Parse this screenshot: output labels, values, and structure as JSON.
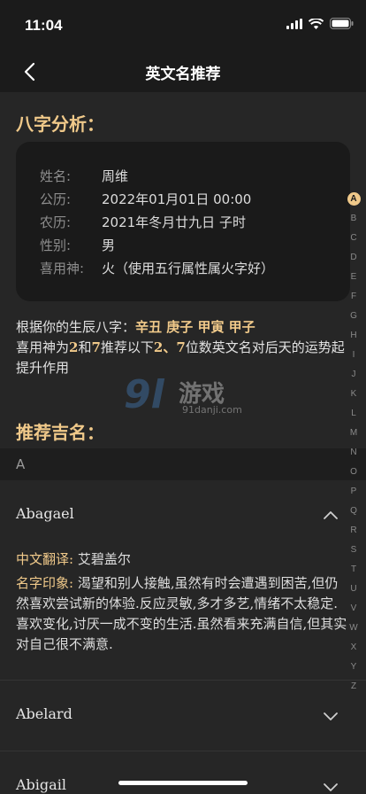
{
  "status": {
    "time": "11:04"
  },
  "nav": {
    "title": "英文名推荐"
  },
  "bazi_section": {
    "title": "八字分析："
  },
  "info": [
    {
      "label": "姓名:",
      "value": "周维"
    },
    {
      "label": "公历:",
      "value": "2022年01月01日 00:00"
    },
    {
      "label": "农历:",
      "value": "2021年冬月廿九日 子时"
    },
    {
      "label": "性别:",
      "value": "男"
    },
    {
      "label": "喜用神:",
      "value": "火（使用五行属性属火字好）"
    }
  ],
  "description": {
    "prefix": "根据你的生辰八字：",
    "bazi": "辛丑 庚子 甲寅 甲子",
    "line2_a": "喜用神为",
    "num1": "2",
    "line2_b": "和",
    "num2": "7",
    "line2_c": "推荐以下",
    "nums": "2、7",
    "line2_d": "位数英文名对后天的运势起提升作用"
  },
  "watermark": {
    "logo": "9l",
    "text": "游戏",
    "url": "91danji.com"
  },
  "recommend_section": {
    "title": "推荐吉名："
  },
  "group": {
    "letter": "A"
  },
  "names": [
    {
      "name": "Abagael",
      "expanded": true,
      "translation_label": "中文翻译:",
      "translation": "艾碧盖尔",
      "impression_label": "名字印象:",
      "impression": "渴望和别人接触,虽然有时会遭遇到困苦,但仍然喜欢尝试新的体验.反应灵敏,多才多艺,情绪不太稳定.喜欢变化,讨厌一成不变的生活.虽然看来充满自信,但其实对自己很不满意."
    },
    {
      "name": "Abelard",
      "expanded": false
    },
    {
      "name": "Abigail",
      "expanded": false
    }
  ],
  "index_letters": [
    "A",
    "B",
    "C",
    "D",
    "E",
    "F",
    "G",
    "H",
    "I",
    "J",
    "K",
    "L",
    "M",
    "N",
    "O",
    "P",
    "Q",
    "R",
    "S",
    "T",
    "U",
    "V",
    "W",
    "X",
    "Y",
    "Z"
  ],
  "index_active": "A",
  "colors": {
    "accent": "#f0c98a",
    "background": "#262626",
    "card": "#1a1a1a"
  }
}
